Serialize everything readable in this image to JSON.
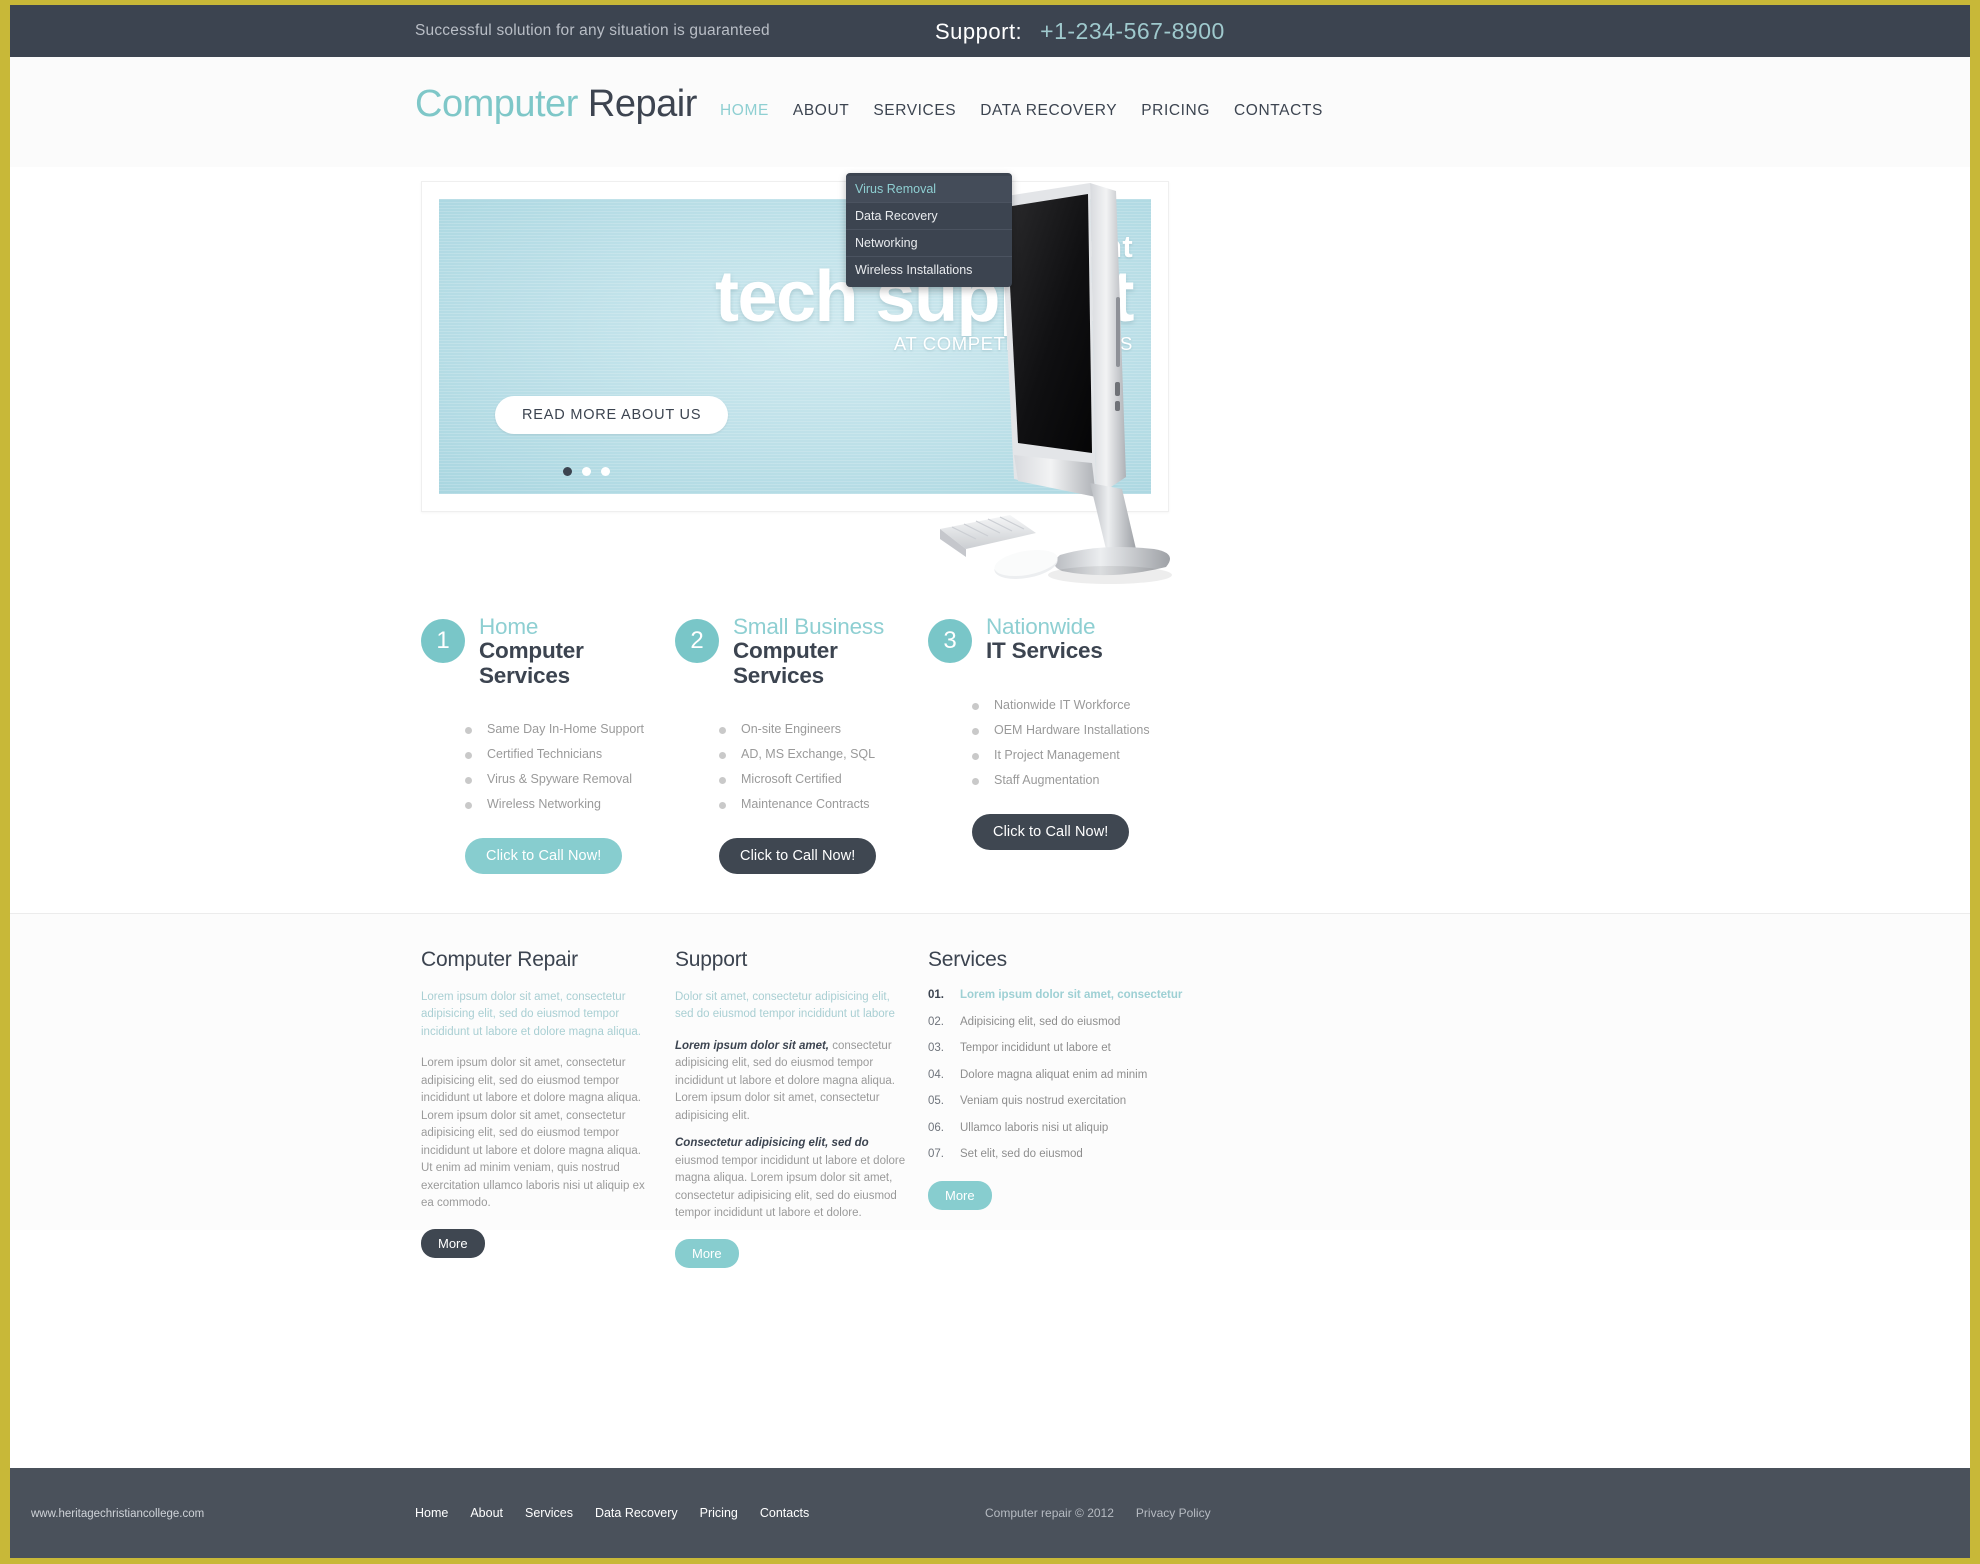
{
  "topbar": {
    "tagline": "Successful solution for any situation is guaranteed",
    "support_label": "Support:",
    "support_phone": "+1-234-567-8900"
  },
  "header": {
    "logo_part1": "Computer",
    "logo_part2": "Repair",
    "nav": [
      {
        "label": "HOME",
        "active": true
      },
      {
        "label": "ABOUT",
        "active": false
      },
      {
        "label": "SERVICES",
        "active": false
      },
      {
        "label": "DATA RECOVERY",
        "active": false
      },
      {
        "label": "PRICING",
        "active": false
      },
      {
        "label": "CONTACTS",
        "active": false
      }
    ],
    "dropdown": {
      "parent": "SERVICES",
      "items": [
        {
          "label": "Virus Removal",
          "highlighted": true
        },
        {
          "label": "Data Recovery",
          "highlighted": false
        },
        {
          "label": "Networking",
          "highlighted": false
        },
        {
          "label": "Wireless Installations",
          "highlighted": false
        }
      ]
    }
  },
  "hero": {
    "line1": "Offering excellent",
    "line2": "tech support",
    "line3": "AT COMPETITIVE PRICES",
    "button": "READ MORE ABOUT US",
    "slide_count": 3,
    "active_slide": 1
  },
  "services": {
    "columns": [
      {
        "number": "1",
        "title_top": "Home",
        "title_bottom_1": "Computer",
        "title_bottom_2": "Services",
        "items": [
          "Same Day In-Home Support",
          "Certified Technicians",
          "Virus & Spyware Removal",
          "Wireless Networking"
        ],
        "button": "Click to Call Now!",
        "button_style": "teal"
      },
      {
        "number": "2",
        "title_top": "Small Business",
        "title_bottom_1": "Computer",
        "title_bottom_2": "Services",
        "items": [
          "On-site Engineers",
          "AD, MS Exchange, SQL",
          "Microsoft Certified",
          "Maintenance Contracts"
        ],
        "button": "Click to Call Now!",
        "button_style": "dark"
      },
      {
        "number": "3",
        "title_top": "Nationwide",
        "title_bottom_1": "IT Services",
        "title_bottom_2": "",
        "items": [
          "Nationwide IT Workforce",
          "OEM Hardware Installations",
          "It Project Management",
          "Staff Augmentation"
        ],
        "button": "Click to Call Now!",
        "button_style": "dark"
      }
    ]
  },
  "lower": {
    "col1": {
      "title": "Computer Repair",
      "intro": "Lorem ipsum dolor sit amet, consectetur adipisicing elit, sed do eiusmod tempor incididunt ut labore et dolore magna aliqua.",
      "body": "Lorem ipsum dolor sit amet, consectetur adipisicing elit, sed do eiusmod tempor incididunt ut labore et dolore magna aliqua.  Lorem ipsum dolor sit amet, consectetur adipisicing elit, sed do eiusmod tempor incididunt ut labore et dolore magna aliqua. Ut enim ad minim veniam, quis nostrud exercitation ullamco laboris nisi ut aliquip ex ea commodo.",
      "more": "More"
    },
    "col2": {
      "title": "Support",
      "intro": "Dolor sit amet, consectetur adipisicing elit, sed do eiusmod tempor incididunt ut labore",
      "para1_bold": "Lorem ipsum dolor sit amet,",
      "para1_rest": " consectetur adipisicing elit, sed do eiusmod tempor incididunt ut labore et dolore magna aliqua.  Lorem ipsum dolor sit amet, consectetur adipisicing elit.",
      "para2_bold": "Consectetur adipisicing elit, sed do",
      "para2_rest": " eiusmod tempor incididunt ut labore et dolore magna aliqua.  Lorem ipsum dolor sit amet, consectetur adipisicing elit, sed do eiusmod tempor incididunt ut labore et dolore.",
      "more": "More"
    },
    "col3": {
      "title": "Services",
      "items": [
        {
          "num": "01.",
          "text": "Lorem ipsum dolor sit amet, consectetur",
          "active": true
        },
        {
          "num": "02.",
          "text": "Adipisicing elit, sed do eiusmod",
          "active": false
        },
        {
          "num": "03.",
          "text": "Tempor incididunt ut labore et",
          "active": false
        },
        {
          "num": "04.",
          "text": "Dolore magna aliquat enim ad minim",
          "active": false
        },
        {
          "num": "05.",
          "text": "Veniam quis nostrud exercitation",
          "active": false
        },
        {
          "num": "06.",
          "text": "Ullamco laboris nisi ut aliquip",
          "active": false
        },
        {
          "num": "07.",
          "text": "Set elit, sed do eiusmod",
          "active": false
        }
      ],
      "more": "More"
    }
  },
  "footer": {
    "site_url": "www.heritagechristiancollege.com",
    "nav": [
      "Home",
      "About",
      "Services",
      "Data Recovery",
      "Pricing",
      "Contacts"
    ],
    "copyright": "Computer repair © 2012",
    "privacy": "Privacy Policy"
  },
  "colors": {
    "accent_teal": "#8ecfd2",
    "dark_slate": "#3c4450",
    "frame_olive": "#c8b838",
    "footer_slate": "#4a515b"
  }
}
